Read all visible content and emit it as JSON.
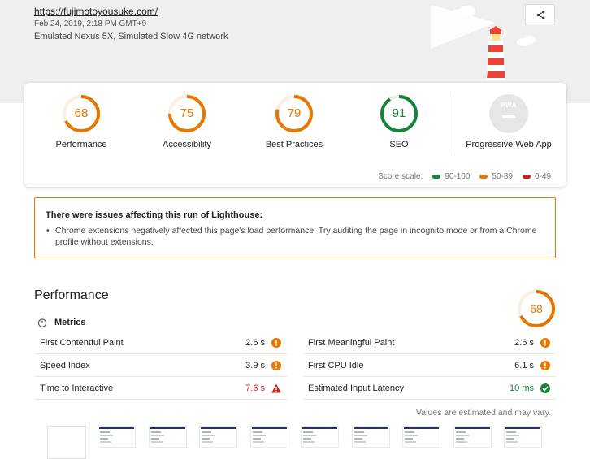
{
  "header": {
    "url": "https://fujimotoyousuke.com/",
    "date": "Feb 24, 2019, 2:18 PM GMT+9",
    "environment": "Emulated Nexus 5X, Simulated Slow 4G network",
    "share_icon": "share-icon"
  },
  "gauges": [
    {
      "label": "Performance",
      "score": "68",
      "color": "#e67700",
      "fraction": 0.68
    },
    {
      "label": "Accessibility",
      "score": "75",
      "color": "#e67700",
      "fraction": 0.75
    },
    {
      "label": "Best Practices",
      "score": "79",
      "color": "#e67700",
      "fraction": 0.79
    },
    {
      "label": "SEO",
      "score": "91",
      "color": "#178239",
      "fraction": 0.91
    }
  ],
  "pwa": {
    "label": "Progressive Web App",
    "badge": "PWA"
  },
  "scale": {
    "title": "Score scale:",
    "pass": {
      "label": "90-100",
      "color": "#178239"
    },
    "average": {
      "label": "50-89",
      "color": "#e67700"
    },
    "fail": {
      "label": "0-49",
      "color": "#c7221f"
    }
  },
  "warning": {
    "title": "There were issues affecting this run of Lighthouse:",
    "item": "Chrome extensions negatively affected this page's load performance. Try auditing the page in incognito mode or from a Chrome profile without extensions.",
    "border_color": "#e67700"
  },
  "performance": {
    "title": "Performance",
    "score": "68",
    "fraction": 0.68,
    "metrics_label": "Metrics",
    "metrics": [
      {
        "name": "First Contentful Paint",
        "value": "2.6 s",
        "status": "average"
      },
      {
        "name": "First Meaningful Paint",
        "value": "2.6 s",
        "status": "average"
      },
      {
        "name": "Speed Index",
        "value": "3.9 s",
        "status": "average"
      },
      {
        "name": "First CPU Idle",
        "value": "6.1 s",
        "status": "average"
      },
      {
        "name": "Time to Interactive",
        "value": "7.6 s",
        "status": "fail"
      },
      {
        "name": "Estimated Input Latency",
        "value": "10 ms",
        "status": "pass"
      }
    ],
    "note": "Values are estimated and may vary."
  }
}
